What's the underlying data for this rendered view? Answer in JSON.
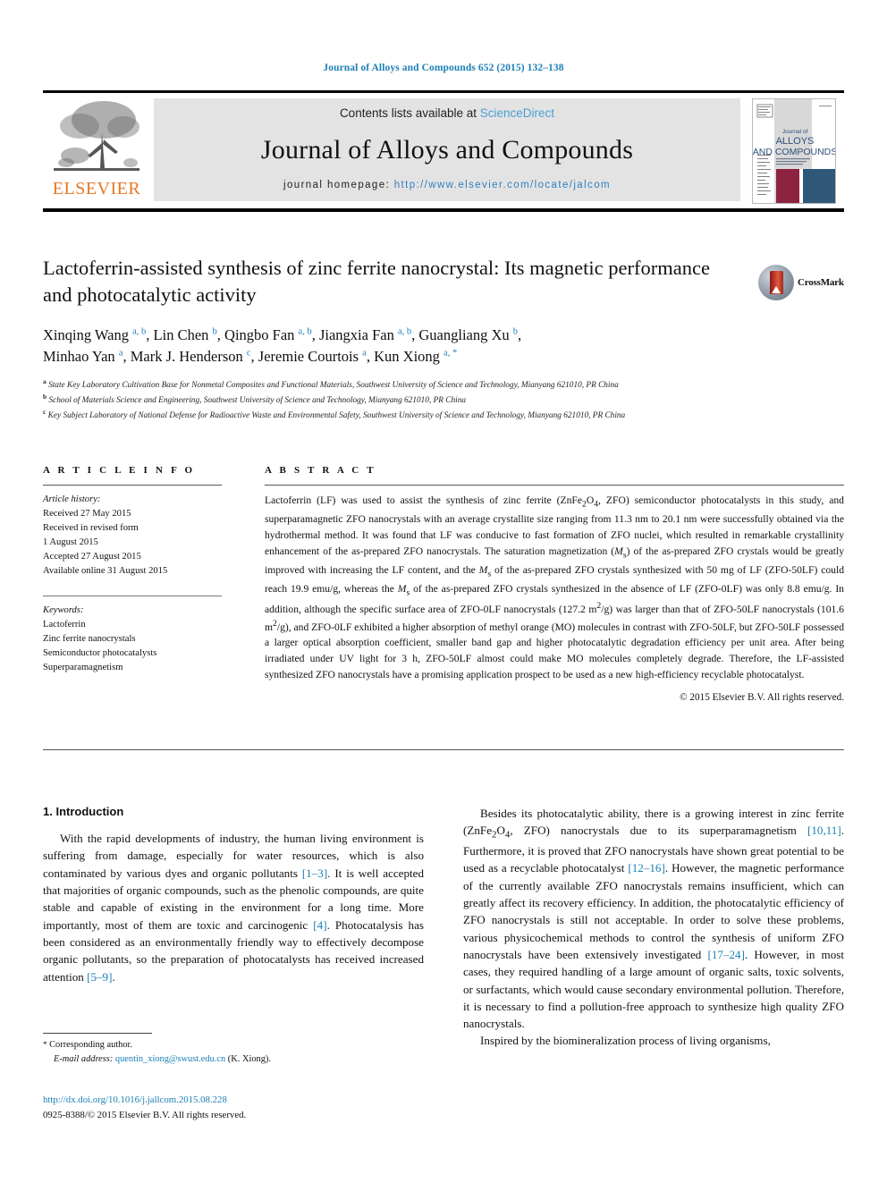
{
  "running_head": "Journal of Alloys and Compounds 652 (2015) 132–138",
  "masthead": {
    "contents_prefix": "Contents lists available at ",
    "sciencedirect": "ScienceDirect",
    "journal_title": "Journal of Alloys and Compounds",
    "homepage_prefix": "journal homepage: ",
    "homepage_url": "http://www.elsevier.com/locate/jalcom",
    "publisher": "ELSEVIER",
    "cover_title_line1": "Journal of",
    "cover_title_line2": "ALLOYS",
    "cover_title_line3": "AND COMPOUNDS",
    "accent_link_color": "#2f7fc0",
    "band_color": "#e3e3e3",
    "elsevier_orange": "#E87722"
  },
  "article": {
    "title": "Lactoferrin-assisted synthesis of zinc ferrite nanocrystal: Its magnetic performance and photocatalytic activity",
    "crossmark_label": "CrossMark",
    "authors_line1_html": "Xinqing Wang <sup>a, b</sup>, Lin Chen <sup>b</sup>, Qingbo Fan <sup>a, b</sup>, Jiangxia Fan <sup>a, b</sup>, Guangliang Xu <sup>b</sup>,",
    "authors_line2_html": "Minhao Yan <sup>a</sup>, Mark J. Henderson <sup>c</sup>, Jeremie Courtois <sup>a</sup>, Kun Xiong <sup>a, *</sup>",
    "affiliations": [
      {
        "marker": "a",
        "text": "State Key Laboratory Cultivation Base for Nonmetal Composites and Functional Materials, Southwest University of Science and Technology, Mianyang 621010, PR China"
      },
      {
        "marker": "b",
        "text": "School of Materials Science and Engineering, Southwest University of Science and Technology, Mianyang 621010, PR China"
      },
      {
        "marker": "c",
        "text": "Key Subject Laboratory of National Defense for Radioactive Waste and Environmental Safety, Southwest University of Science and Technology, Mianyang 621010, PR China"
      }
    ]
  },
  "article_info": {
    "heading": "A R T I C L E  I N F O",
    "history_label": "Article history:",
    "history": [
      "Received 27 May 2015",
      "Received in revised form",
      "1 August 2015",
      "Accepted 27 August 2015",
      "Available online 31 August 2015"
    ],
    "keywords_label": "Keywords:",
    "keywords": [
      "Lactoferrin",
      "Zinc ferrite nanocrystals",
      "Semiconductor photocatalysts",
      "Superparamagnetism"
    ]
  },
  "abstract": {
    "heading": "A B S T R A C T",
    "body_html": "Lactoferrin (LF) was used to assist the synthesis of zinc ferrite (ZnFe<sub>2</sub>O<sub>4</sub>, ZFO) semiconductor photocatalysts in this study, and superparamagnetic ZFO nanocrystals with an average crystallite size ranging from 11.3 nm to 20.1 nm were successfully obtained via the hydrothermal method. It was found that LF was conducive to fast formation of ZFO nuclei, which resulted in remarkable crystallinity enhancement of the as-prepared ZFO nanocrystals. The saturation magnetization (<i>M</i><sub>s</sub>) of the as-prepared ZFO crystals would be greatly improved with increasing the LF content, and the <i>M</i><sub>s</sub> of the as-prepared ZFO crystals synthesized with 50 mg of LF (ZFO-50LF) could reach 19.9 emu/g, whereas the <i>M</i><sub>s</sub> of the as-prepared ZFO crystals synthesized in the absence of LF (ZFO-0LF) was only 8.8 emu/g. In addition, although the specific surface area of ZFO-0LF nanocrystals (127.2 m<sup>2</sup>/g) was larger than that of ZFO-50LF nanocrystals (101.6 m<sup>2</sup>/g), and ZFO-0LF exhibited a higher absorption of methyl orange (MO) molecules in contrast with ZFO-50LF, but ZFO-50LF possessed a larger optical absorption coefficient, smaller band gap and higher photocatalytic degradation efficiency per unit area. After being irradiated under UV light for 3 h, ZFO-50LF almost could make MO molecules completely degrade. Therefore, the LF-assisted synthesized ZFO nanocrystals have a promising application prospect to be used as a new high-efficiency recyclable photocatalyst.",
    "copyright": "© 2015 Elsevier B.V. All rights reserved."
  },
  "introduction": {
    "section_number_title": "1.  Introduction",
    "left_paragraph_html": "With the rapid developments of industry, the human living environment is suffering from damage, especially for water resources, which is also contaminated by various dyes and organic pollutants <span class=\"ref\">[1–3]</span>. It is well accepted that majorities of organic compounds, such as the phenolic compounds, are quite stable and capable of existing in the environment for a long time. More importantly, most of them are toxic and carcinogenic <span class=\"ref\">[4]</span>. Photocatalysis has been considered as an environmentally friendly way to effectively decompose organic pollutants, so the preparation of photocatalysts has received increased attention <span class=\"ref\">[5–9]</span>.",
    "right_paragraph_1_html": "Besides its photocatalytic ability, there is a growing interest in zinc ferrite (ZnFe<sub>2</sub>O<sub>4</sub>, ZFO) nanocrystals due to its superparamagnetism <span class=\"ref\">[10,11]</span>. Furthermore, it is proved that ZFO nanocrystals have shown great potential to be used as a recyclable photocatalyst <span class=\"ref\">[12–16]</span>. However, the magnetic performance of the currently available ZFO nanocrystals remains insufficient, which can greatly affect its recovery efficiency. In addition, the photocatalytic efficiency of ZFO nanocrystals is still not acceptable. In order to solve these problems, various physicochemical methods to control the synthesis of uniform ZFO nanocrystals have been extensively investigated <span class=\"ref\">[17–24]</span>. However, in most cases, they required handling of a large amount of organic salts, toxic solvents, or surfactants, which would cause secondary environmental pollution. Therefore, it is necessary to find a pollution-free approach to synthesize high quality ZFO nanocrystals.",
    "right_paragraph_2_html": "Inspired by the biomineralization process of living organisms,"
  },
  "footnote": {
    "star": "*",
    "corresponding_author": "Corresponding author.",
    "email_label": "E-mail address:",
    "email": "quentin_xiong@swust.edu.cn",
    "email_owner": "(K. Xiong)."
  },
  "footer": {
    "doi": "http://dx.doi.org/10.1016/j.jallcom.2015.08.228",
    "issn_line": "0925-8388/© 2015 Elsevier B.V. All rights reserved."
  }
}
